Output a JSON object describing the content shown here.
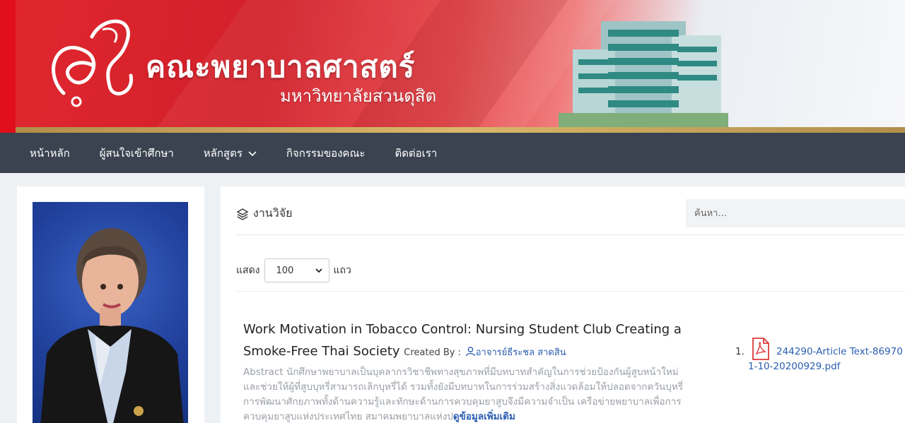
{
  "header": {
    "title": "คณะพยาบาลศาสตร์",
    "subtitle": "มหาวิทยาลัยสวนดุสิต"
  },
  "nav": {
    "items": [
      {
        "label": "หน้าหลัก"
      },
      {
        "label": "ผู้สนใจเข้าศึกษา"
      },
      {
        "label": "หลักสูตร"
      },
      {
        "label": "กิจกรรมของคณะ"
      },
      {
        "label": "ติดต่อเรา"
      }
    ]
  },
  "panel": {
    "title": "งานวิจัย",
    "search_placeholder": "ค้นหา...",
    "show_label": "แสดง",
    "rows_label": "แถว",
    "page_size": "100"
  },
  "entry": {
    "title": "Work Motivation in Tobacco Control: Nursing Student Club Creating a Smoke-Free Thai Society",
    "created_by_label": "Created By :",
    "author": "อาจารย์ธีระชล สาดสิน",
    "abstract": "Abstract นักศึกษาพยาบาลเป็นบุคลากรวิชาชีพทางสุขภาพที่มีบทบาทสำคัญในการช่วยป้องกันผู้สูบหน้าใหม่ และช่วยให้ผู้ที่สูบบุหรี่สามารถเลิกบุหรี่ได้ รวมทั้งยังมีบทบาทในการร่วมสร้างสิ่งแวดล้อมให้ปลอดจากควันบุหรี่ การพัฒนาศักยภาพทั้งด้านความรู้และทักษะด้านการควบคุมยาสูบจึงมีความจำเป็น เครือข่ายพยาบาลเพื่อการควบคุมยาสูบแห่งประเทศไทย สมาคมพยาบาลแห่งป",
    "more_label": "ดูข้อมูลเพิ่มเติม",
    "file_index": "1.",
    "file_name_line1": "244290-Article Text-86970",
    "file_name_line2": "1-10-20200929.pdf"
  }
}
